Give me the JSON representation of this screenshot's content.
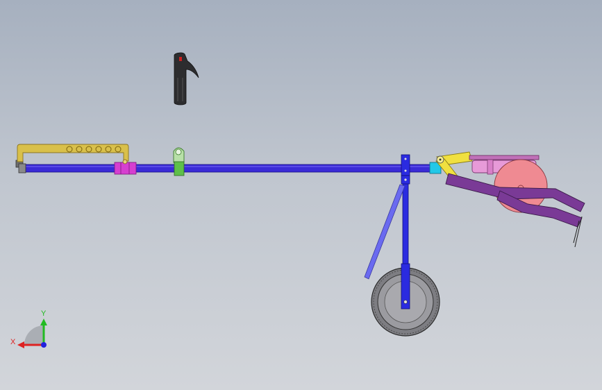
{
  "view": {
    "background_top": "#a6b0bf",
    "background_bottom": "#d2d5da"
  },
  "triad": {
    "y_label": "Y",
    "x_label": "X",
    "y_color": "#22bb22",
    "x_color": "#dd2222",
    "z_color": "#2222dd"
  },
  "parts": {
    "main_tube_color": "#3a2bd6",
    "handle_bracket_color": "#d9c04a",
    "collar_color": "#d63fd0",
    "clamp_color": "#5fbf4a",
    "wheel_strut_color": "#2b2be0",
    "wheel_color": "#7d7d82",
    "linkage_color": "#f0e040",
    "block_color": "#22c8e8",
    "cylinder_color": "#e79ad8",
    "disc_color": "#ef8a92",
    "arm_color": "#7a3a96",
    "grip_color": "#2d2d2f"
  }
}
